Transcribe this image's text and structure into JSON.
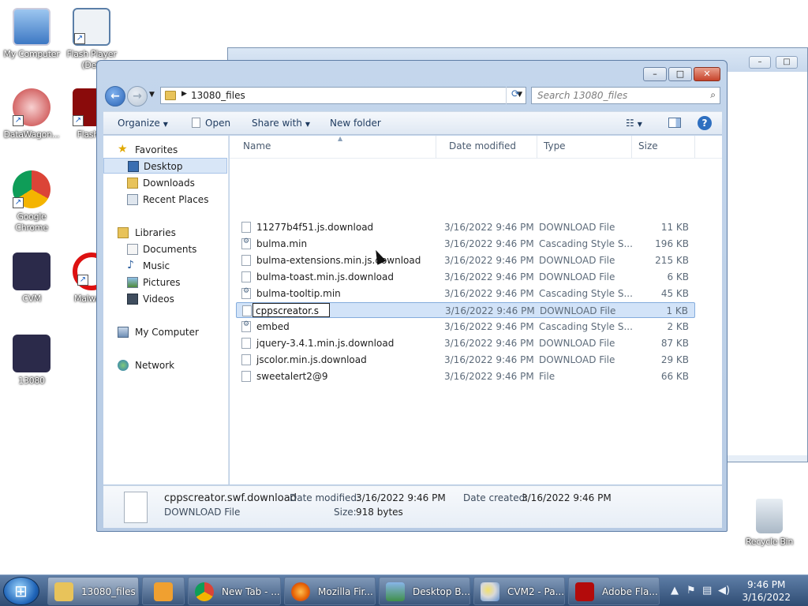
{
  "desktop": {
    "icons": [
      {
        "label": "My Computer"
      },
      {
        "label": "Flash Player (Deb"
      },
      {
        "label": "DataWagon..."
      },
      {
        "label": "Flash P"
      },
      {
        "label": "Google Chrome"
      },
      {
        "label": "Malware"
      },
      {
        "label": "CVM"
      },
      {
        "label": "13080"
      },
      {
        "label": "Recycle Bin"
      }
    ]
  },
  "explorer": {
    "breadcrumb": "13080_files",
    "search_placeholder": "Search 13080_files",
    "toolbar": {
      "organize": "Organize",
      "open": "Open",
      "share_with": "Share with",
      "new_folder": "New folder"
    },
    "nav": {
      "favorites": "Favorites",
      "desktop": "Desktop",
      "downloads": "Downloads",
      "recent": "Recent Places",
      "libraries": "Libraries",
      "documents": "Documents",
      "music": "Music",
      "pictures": "Pictures",
      "videos": "Videos",
      "computer": "My Computer",
      "network": "Network"
    },
    "columns": {
      "name": "Name",
      "date": "Date modified",
      "type": "Type",
      "size": "Size"
    },
    "files": [
      {
        "name": "11277b4f51.js.download",
        "date": "3/16/2022 9:46 PM",
        "type": "DOWNLOAD File",
        "size": "11 KB",
        "icon": "file"
      },
      {
        "name": "bulma.min",
        "date": "3/16/2022 9:46 PM",
        "type": "Cascading Style S...",
        "size": "196 KB",
        "icon": "css"
      },
      {
        "name": "bulma-extensions.min.js.download",
        "date": "3/16/2022 9:46 PM",
        "type": "DOWNLOAD File",
        "size": "215 KB",
        "icon": "file"
      },
      {
        "name": "bulma-toast.min.js.download",
        "date": "3/16/2022 9:46 PM",
        "type": "DOWNLOAD File",
        "size": "6 KB",
        "icon": "file"
      },
      {
        "name": "bulma-tooltip.min",
        "date": "3/16/2022 9:46 PM",
        "type": "Cascading Style S...",
        "size": "45 KB",
        "icon": "css"
      },
      {
        "name": "cppscreator.s",
        "date": "3/16/2022 9:46 PM",
        "type": "DOWNLOAD File",
        "size": "1 KB",
        "icon": "file",
        "renaming": true
      },
      {
        "name": "embed",
        "date": "3/16/2022 9:46 PM",
        "type": "Cascading Style S...",
        "size": "2 KB",
        "icon": "css"
      },
      {
        "name": "jquery-3.4.1.min.js.download",
        "date": "3/16/2022 9:46 PM",
        "type": "DOWNLOAD File",
        "size": "87 KB",
        "icon": "file"
      },
      {
        "name": "jscolor.min.js.download",
        "date": "3/16/2022 9:46 PM",
        "type": "DOWNLOAD File",
        "size": "29 KB",
        "icon": "file"
      },
      {
        "name": "sweetalert2@9",
        "date": "3/16/2022 9:46 PM",
        "type": "File",
        "size": "66 KB",
        "icon": "file"
      }
    ],
    "details": {
      "filename": "cppscreator.swf.download",
      "filetype": "DOWNLOAD File",
      "date_modified_label": "Date modified:",
      "date_modified": "3/16/2022 9:46 PM",
      "date_created_label": "Date created:",
      "date_created": "3/16/2022 9:46 PM",
      "size_label": "Size:",
      "size": "918 bytes"
    }
  },
  "taskbar": {
    "tasks": [
      {
        "label": "13080_files",
        "icon": "folder-icon",
        "color": "#e8c35a"
      },
      {
        "label": "",
        "icon": "media-player-icon",
        "color": "#f0a030"
      },
      {
        "label": "New Tab - ...",
        "icon": "chrome-icon",
        "color": "#4285f4"
      },
      {
        "label": "Mozilla Fir...",
        "icon": "firefox-icon",
        "color": "#e66000"
      },
      {
        "label": "Desktop B...",
        "icon": "desktop-icon",
        "color": "#3f8f4a"
      },
      {
        "label": "CVM2 - Pa...",
        "icon": "paint-icon",
        "color": "#d9d9d9"
      },
      {
        "label": "Adobe Fla...",
        "icon": "flash-icon",
        "color": "#b30b0b"
      }
    ],
    "time": "9:46 PM",
    "date": "3/16/2022"
  }
}
